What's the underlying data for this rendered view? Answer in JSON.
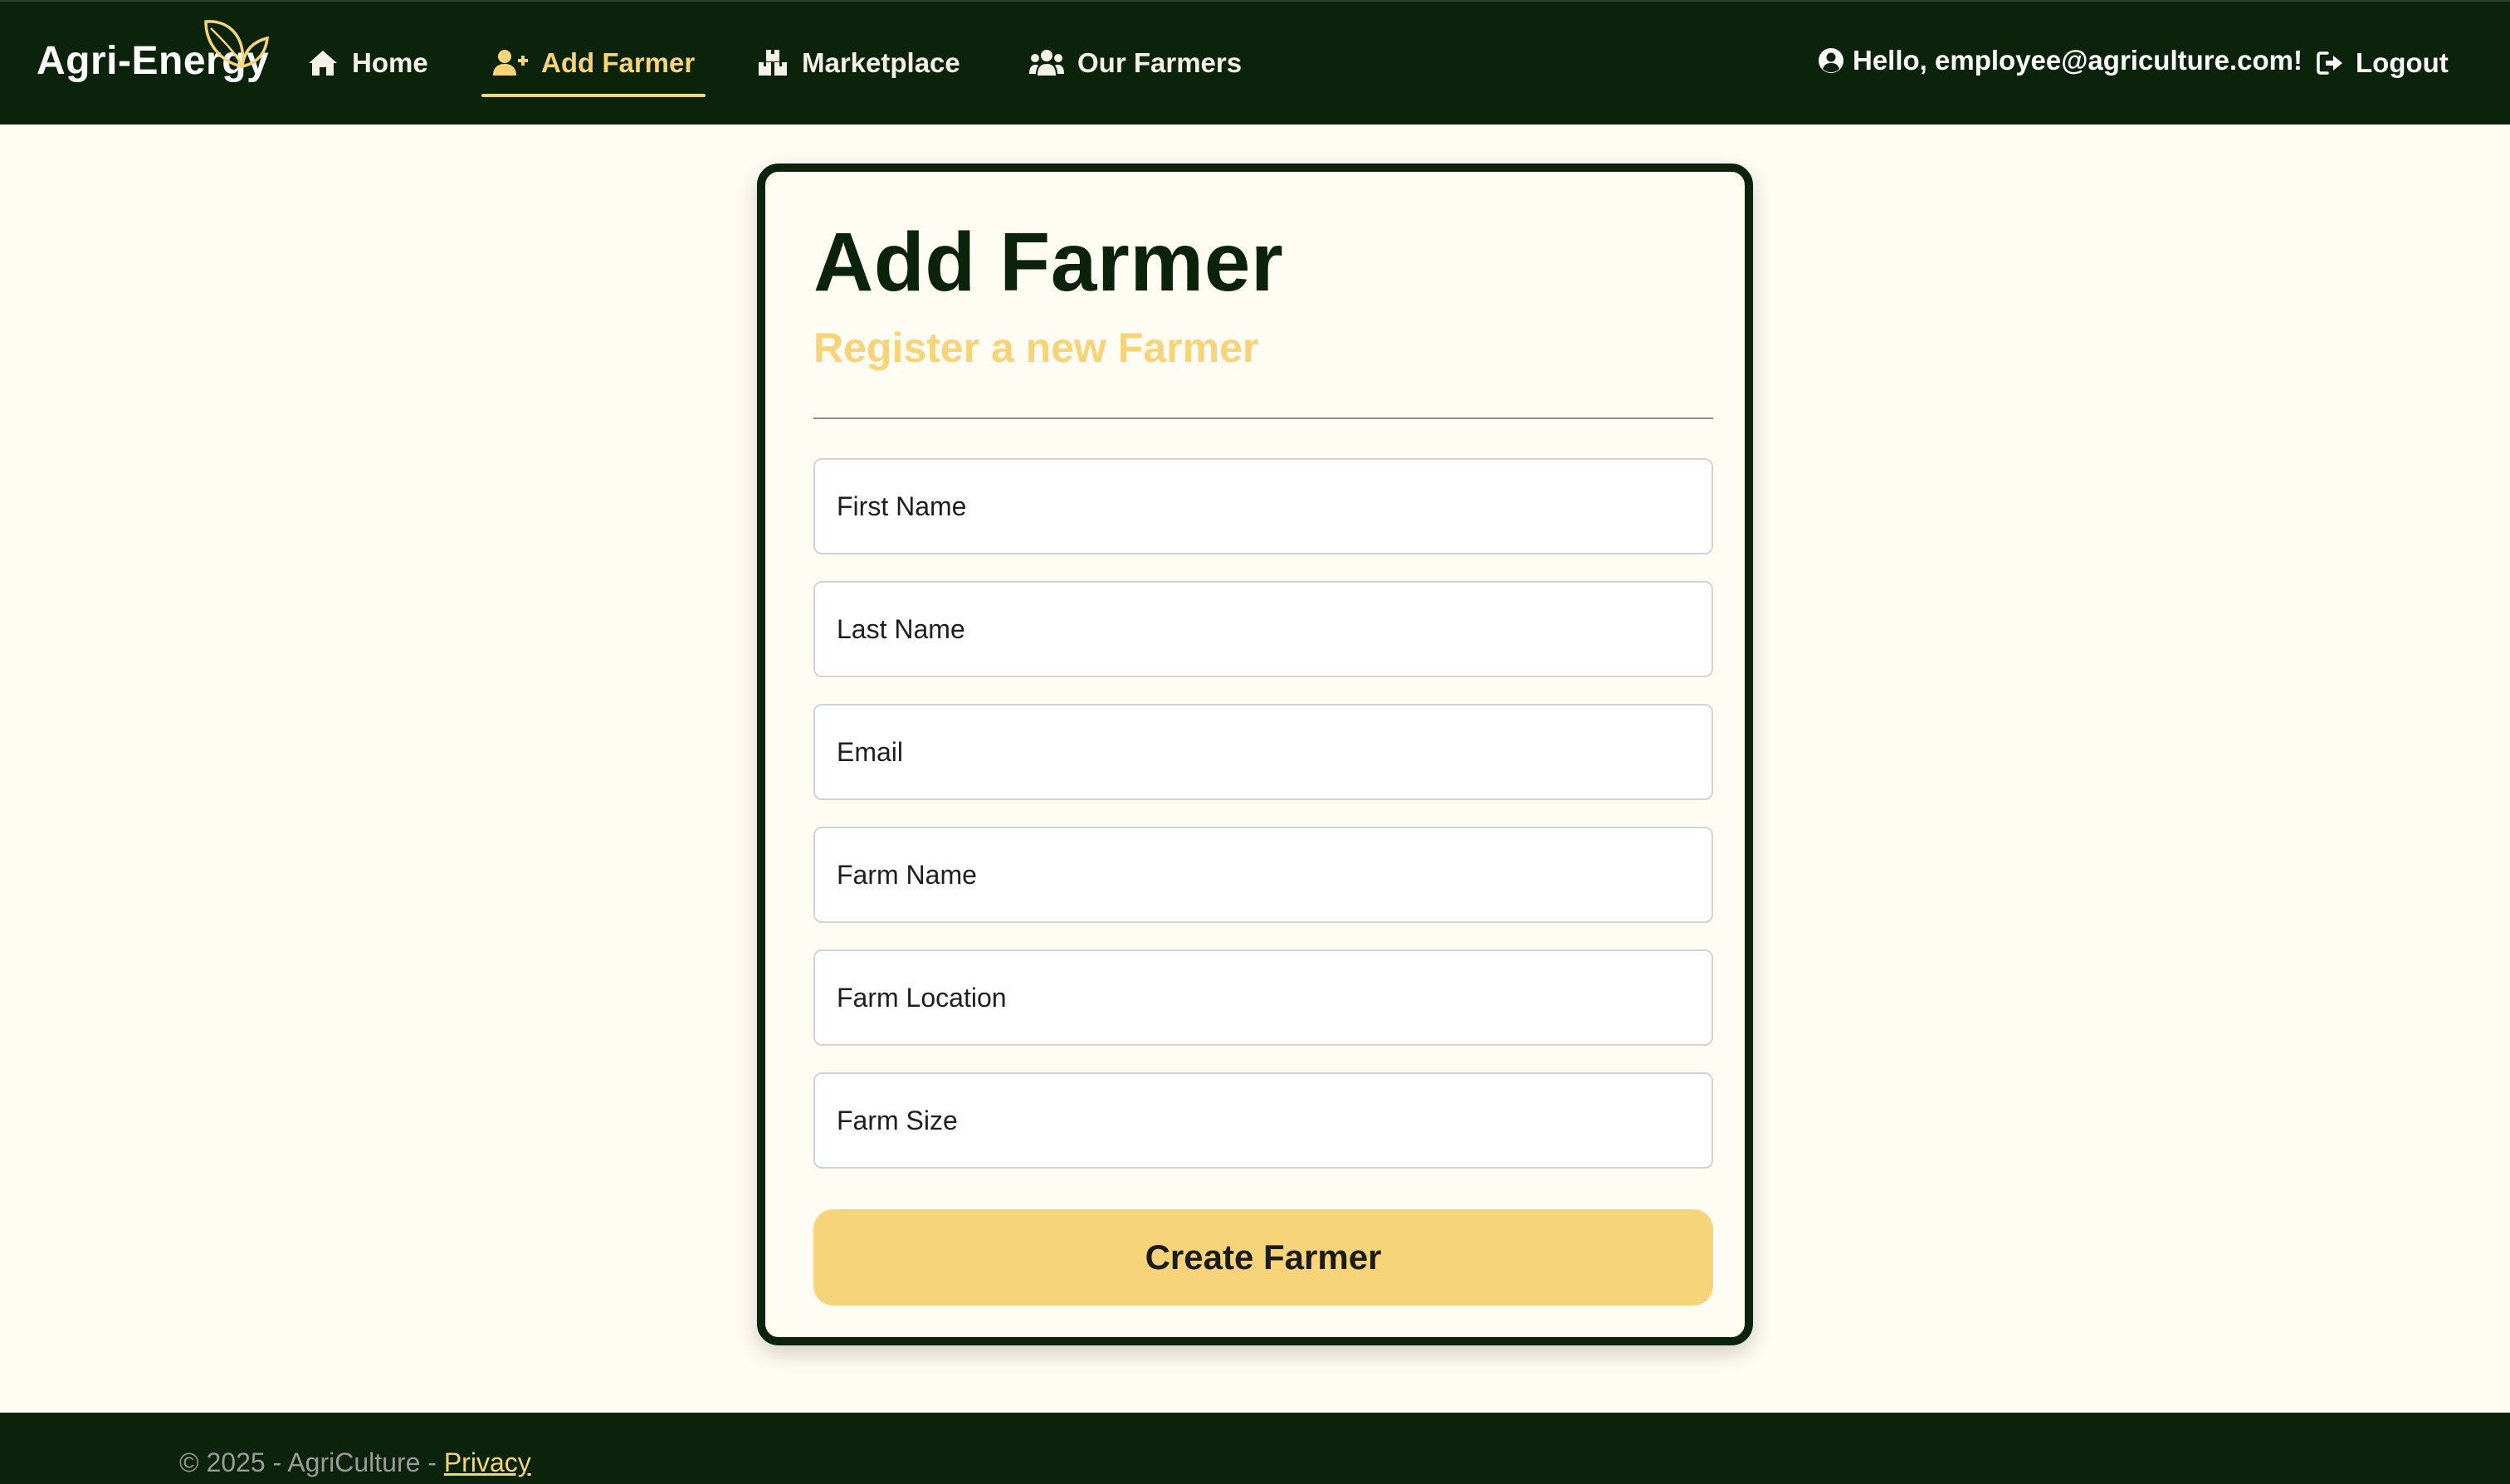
{
  "app": {
    "brand": "Agri-Energy",
    "colors": {
      "nav_bg": "#0b230b",
      "accent": "#f7d47a",
      "page_bg": "#fffcf3"
    }
  },
  "nav": {
    "items": [
      {
        "label": "Home",
        "icon": "home-icon",
        "active": false
      },
      {
        "label": "Add Farmer",
        "icon": "user-plus-icon",
        "active": true
      },
      {
        "label": "Marketplace",
        "icon": "boxes-icon",
        "active": false
      },
      {
        "label": "Our Farmers",
        "icon": "users-icon",
        "active": false
      }
    ],
    "greeting": "Hello, employee@agriculture.com!",
    "greeting_icon": "user-circle-icon",
    "logout": "Logout",
    "logout_icon": "sign-out-icon"
  },
  "form": {
    "title": "Add Farmer",
    "subtitle": "Register a new Farmer",
    "fields": {
      "first_name": {
        "placeholder": "First Name",
        "value": ""
      },
      "last_name": {
        "placeholder": "Last Name",
        "value": ""
      },
      "email": {
        "placeholder": "Email",
        "value": ""
      },
      "farm_name": {
        "placeholder": "Farm Name",
        "value": ""
      },
      "farm_location": {
        "placeholder": "Farm Location",
        "value": ""
      },
      "farm_size": {
        "placeholder": "Farm Size",
        "value": ""
      }
    },
    "submit_label": "Create Farmer"
  },
  "footer": {
    "text": "© 2025 - AgriCulture - ",
    "privacy_label": "Privacy"
  }
}
